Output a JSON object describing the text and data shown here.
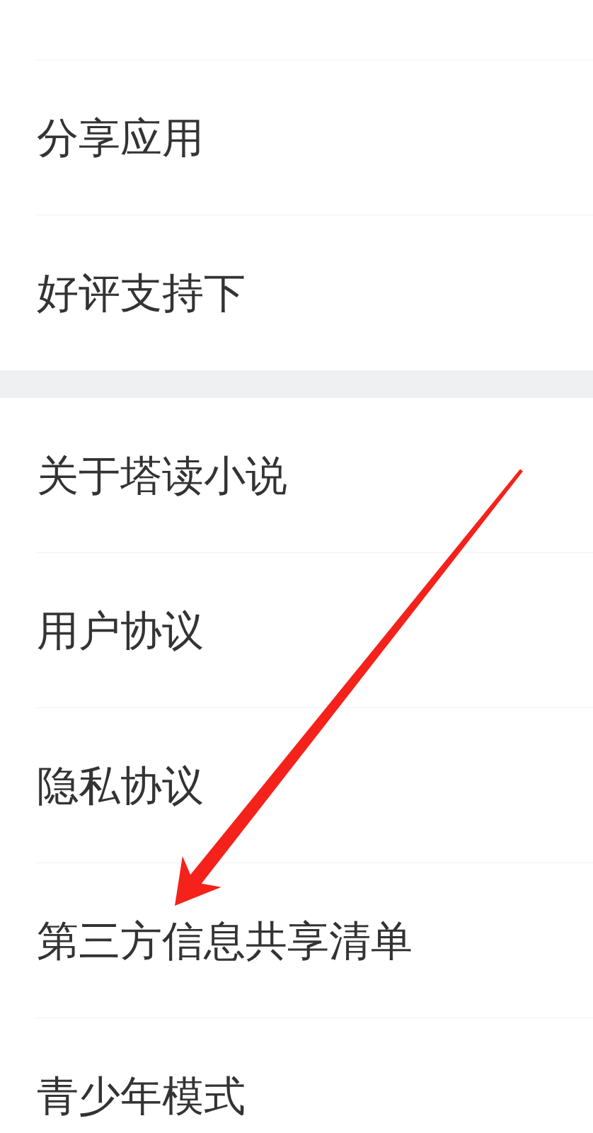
{
  "sections": [
    {
      "items": [
        {
          "label": "分享应用",
          "marked_by_arrow": false
        },
        {
          "label": "好评支持下",
          "marked_by_arrow": false
        }
      ]
    },
    {
      "items": [
        {
          "label": "关于塔读小说",
          "marked_by_arrow": false
        },
        {
          "label": "用户协议",
          "marked_by_arrow": false
        },
        {
          "label": "隐私协议",
          "marked_by_arrow": false
        },
        {
          "label": "第三方信息共享清单",
          "marked_by_arrow": true
        },
        {
          "label": "青少年模式",
          "marked_by_arrow": false
        }
      ]
    }
  ]
}
